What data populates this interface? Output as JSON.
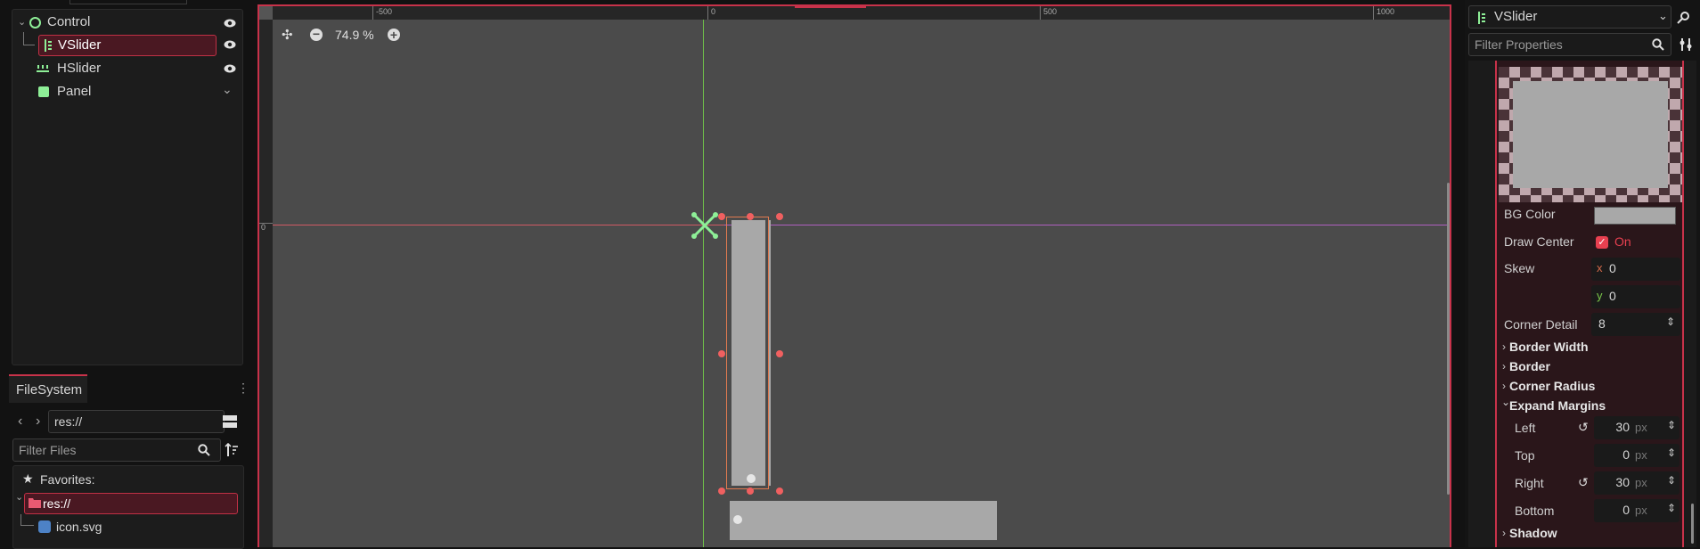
{
  "scene_tree": {
    "items": [
      {
        "label": "Control",
        "icon": "control-node-icon"
      },
      {
        "label": "VSlider",
        "icon": "vslider-icon",
        "selected": true
      },
      {
        "label": "HSlider",
        "icon": "hslider-icon"
      },
      {
        "label": "Panel",
        "icon": "panel-icon"
      }
    ]
  },
  "filesystem": {
    "tab_label": "FileSystem",
    "path_value": "res://",
    "filter_placeholder": "Filter Files",
    "favorites_label": "Favorites:",
    "root_label": "res://",
    "file_label": "icon.svg"
  },
  "viewport": {
    "zoom_label": "74.9 %",
    "ruler_labels": [
      "-500",
      "0",
      "500",
      "1000"
    ],
    "ruler_v_label": "0"
  },
  "inspector": {
    "node_selector": "VSlider",
    "filter_placeholder": "Filter Properties",
    "bg_color_label": "BG Color",
    "draw_center_label": "Draw Center",
    "draw_center_value": "On",
    "skew_label": "Skew",
    "skew_x_axis": "x",
    "skew_x_value": "0",
    "skew_y_axis": "y",
    "skew_y_value": "0",
    "corner_detail_label": "Corner Detail",
    "corner_detail_value": "8",
    "sections": [
      "Border Width",
      "Border",
      "Corner Radius",
      "Expand Margins"
    ],
    "margins": [
      {
        "label": "Left",
        "value": "30",
        "unit": "px"
      },
      {
        "label": "Top",
        "value": "0",
        "unit": "px"
      },
      {
        "label": "Right",
        "value": "30",
        "unit": "px"
      },
      {
        "label": "Bottom",
        "value": "0",
        "unit": "px"
      }
    ],
    "shadow_label": "Shadow"
  },
  "colors": {
    "accent": "#c8324a",
    "viewport_bg": "#4b4b4b",
    "slider_fill": "#a8a8a8",
    "selection_outline": "#e07a50",
    "node_green": "#8eef97"
  }
}
